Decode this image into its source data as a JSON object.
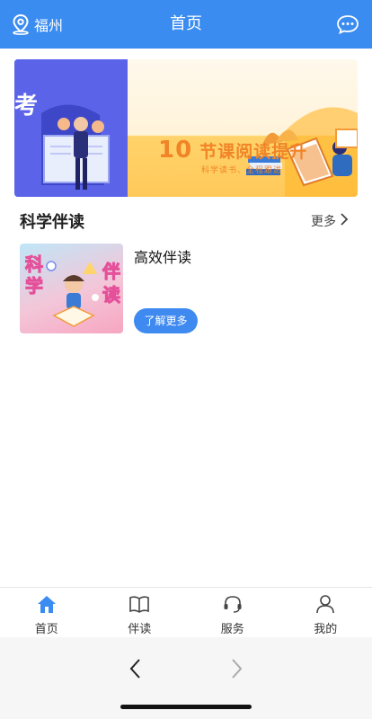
{
  "header": {
    "location": "福州",
    "title": "首页",
    "icons": {
      "location": "location-pin-icon",
      "more": "chat-bubble-dots-icon"
    }
  },
  "banner": {
    "title_number": "10",
    "title_text": "节课阅读提升",
    "subtitle": "科学读书、全程跟进"
  },
  "section": {
    "title": "科学伴读",
    "more_label": "更多"
  },
  "card": {
    "title": "高效伴读",
    "image_text_left": "科学",
    "image_text_right": "伴读",
    "button_label": "了解更多"
  },
  "tabbar": {
    "items": [
      {
        "label": "首页",
        "icon": "home-icon",
        "active": true
      },
      {
        "label": "伴读",
        "icon": "book-icon",
        "active": false
      },
      {
        "label": "服务",
        "icon": "headset-icon",
        "active": false
      },
      {
        "label": "我的",
        "icon": "user-icon",
        "active": false
      }
    ]
  },
  "colors": {
    "primary": "#3b8cf0",
    "accent_orange": "#f08427",
    "banner_purple": "#5b63e8"
  }
}
